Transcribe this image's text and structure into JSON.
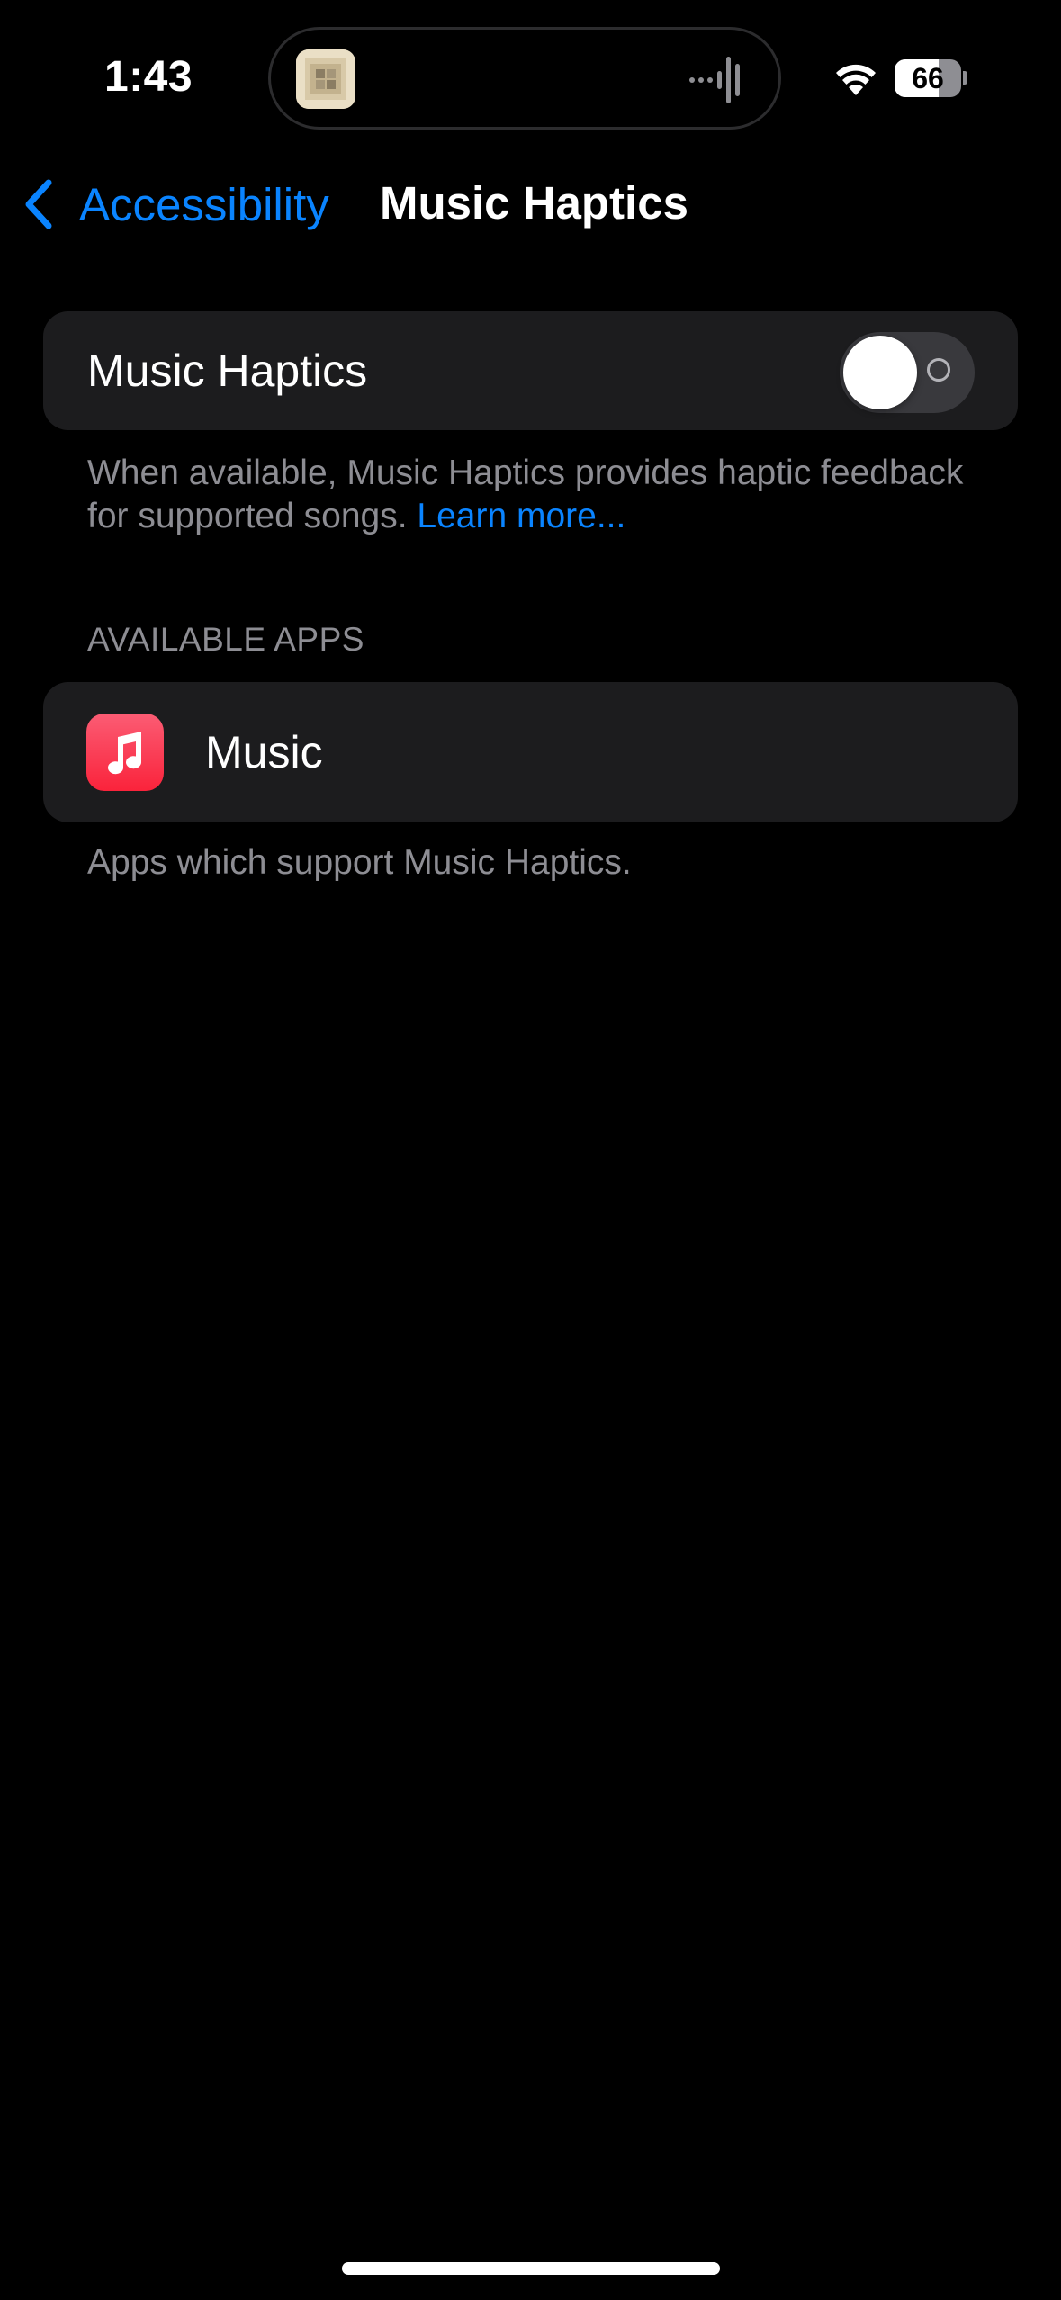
{
  "status_bar": {
    "time": "1:43",
    "battery_level": "66",
    "battery_fraction": 0.66,
    "island_thumbnail_icon": "album-art-thumbnail",
    "island_activity_icon": "audio-waveform-icon",
    "wifi_icon": "wifi-icon"
  },
  "nav": {
    "back_label": "Accessibility",
    "title": "Music Haptics"
  },
  "toggle_group": {
    "label": "Music Haptics",
    "enabled": false,
    "footer_text": "When available, Music Haptics provides haptic feedback for supported songs.",
    "footer_link": "Learn more..."
  },
  "apps_section": {
    "header": "AVAILABLE APPS",
    "items": [
      {
        "label": "Music",
        "icon": "music-note-icon"
      }
    ],
    "footer_text": "Apps which support Music Haptics."
  },
  "colors": {
    "background": "#000000",
    "group_background": "#1c1c1e",
    "accent": "#0a84ff",
    "secondary_text": "#8d8d93",
    "switch_off": "#39393d",
    "music_app": "#fa233b"
  }
}
